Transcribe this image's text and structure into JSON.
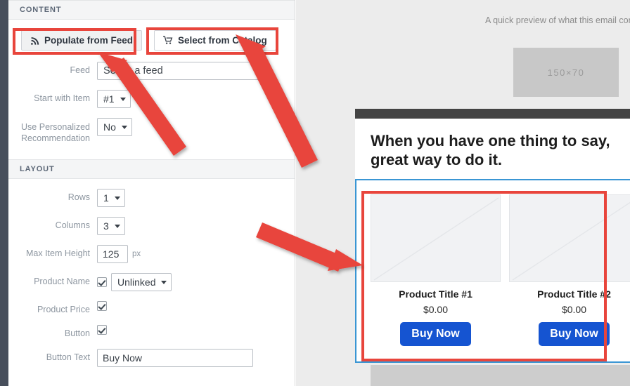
{
  "sections": {
    "content": {
      "title": "CONTENT"
    },
    "layout": {
      "title": "LAYOUT"
    }
  },
  "tabs": [
    {
      "label": "Populate from Feed",
      "icon": "rss-feed-icon",
      "active": true
    },
    {
      "label": "Select from Catalog",
      "icon": "shopping-cart-icon",
      "active": false
    }
  ],
  "content_fields": {
    "feed": {
      "label": "Feed",
      "value": "Select a feed"
    },
    "start_with_item": {
      "label": "Start with Item",
      "value": "#1"
    },
    "personalized_recommendation": {
      "label_line1": "Use Personalized",
      "label_line2": "Recommendation",
      "value": "No"
    }
  },
  "layout_fields": {
    "rows": {
      "label": "Rows",
      "value": "1"
    },
    "columns": {
      "label": "Columns",
      "value": "3"
    },
    "max_item_height": {
      "label": "Max Item Height",
      "value": "125",
      "unit": "px"
    },
    "product_name": {
      "label": "Product Name",
      "checked": true,
      "value": "Unlinked"
    },
    "product_price": {
      "label": "Product Price",
      "checked": true
    },
    "button": {
      "label": "Button",
      "checked": true
    },
    "button_text": {
      "label": "Button Text",
      "value": "Buy Now"
    }
  },
  "preview": {
    "note": "A quick preview of what this email contai",
    "logo_placeholder": "150×70",
    "headline": "When you have one thing to say, great way to do it.",
    "products": [
      {
        "title": "Product Title #1",
        "price": "$0.00",
        "button": "Buy Now"
      },
      {
        "title": "Product Title #2",
        "price": "$0.00",
        "button": "Buy Now"
      }
    ]
  },
  "colors": {
    "highlight": "#e8453c",
    "arrow": "#e8453c",
    "selection_border": "#3a96d4",
    "button_blue": "#1554d1",
    "rail": "#474f5c"
  }
}
